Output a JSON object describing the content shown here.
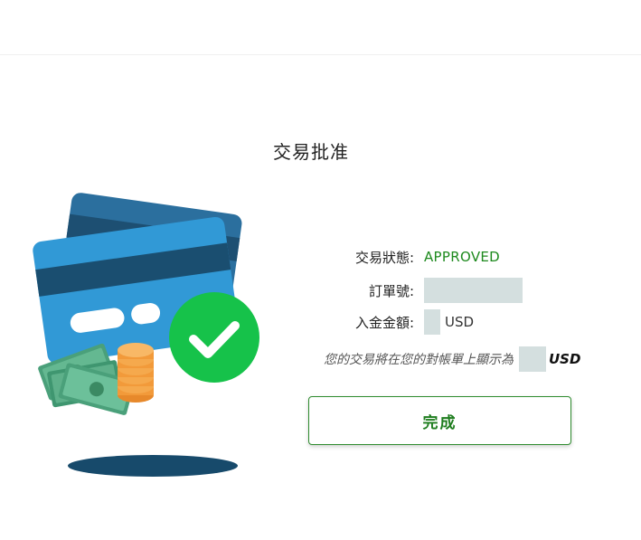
{
  "page": {
    "title": "交易批准"
  },
  "transaction": {
    "status_label": "交易狀態:",
    "status_value": "APPROVED",
    "order_label": "訂單號:",
    "amount_label": "入金金額:",
    "amount_currency": "USD",
    "statement_text": "您的交易將在您的對帳單上顯示為",
    "statement_currency": "USD"
  },
  "actions": {
    "done_label": "完成"
  },
  "colors": {
    "approved": "#1e8a1e",
    "button_border": "#2e8b2e",
    "redacted": "#d4dfdf"
  },
  "illustration": {
    "icons": [
      "credit-card-icon",
      "checkmark-icon",
      "cash-icon",
      "coins-icon"
    ]
  }
}
